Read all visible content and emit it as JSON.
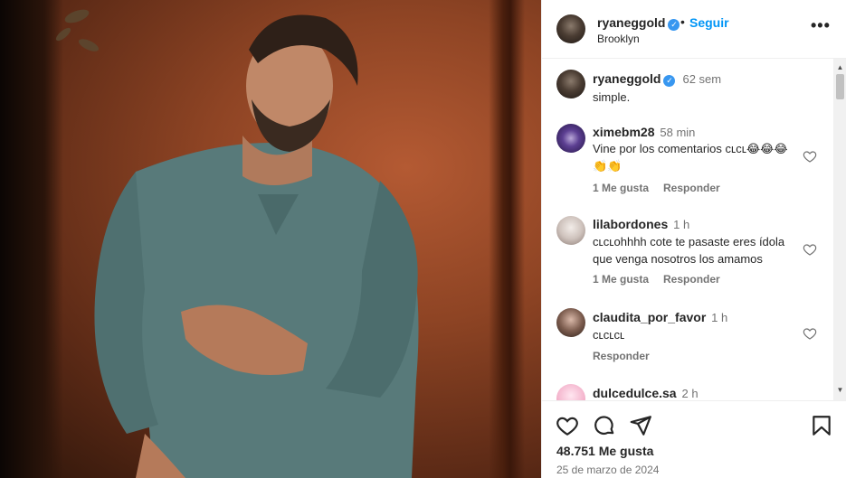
{
  "post": {
    "author": "ryaneggold",
    "follow_label": "Seguir",
    "dot": "•",
    "location": "Brooklyn",
    "more_label": "•••",
    "verified_mark": "✓"
  },
  "caption": {
    "username": "ryaneggold",
    "time": "62 sem",
    "text": "simple."
  },
  "comments": [
    {
      "username": "ximebm28",
      "time": "58 min",
      "text": "Vine por los comentarios ᴄʟᴄʟ😂😂😂👏👏",
      "likes": "1 Me gusta",
      "reply": "Responder"
    },
    {
      "username": "lilabordones",
      "time": "1 h",
      "text": "ᴄʟᴄʟohhhh cote te pasaste eres ídola que venga nosotros los amamos",
      "likes": "1 Me gusta",
      "reply": "Responder"
    },
    {
      "username": "claudita_por_favor",
      "time": "1 h",
      "text": "ᴄʟᴄʟᴄʟ",
      "likes": "",
      "reply": "Responder"
    },
    {
      "username": "dulcedulce.sa",
      "time": "2 h",
      "text": "",
      "likes": "",
      "reply": ""
    }
  ],
  "stats": {
    "likes": "48.751 Me gusta",
    "date": "25 de marzo de 2024"
  },
  "icons": {
    "like": "heart-icon",
    "comment": "comment-icon",
    "share": "send-icon",
    "save": "bookmark-icon",
    "more": "more-options-icon",
    "verified": "verified-badge-icon"
  },
  "colors": {
    "link_blue": "#0095f6",
    "verified_blue": "#3897f0",
    "muted_text": "#737373"
  }
}
